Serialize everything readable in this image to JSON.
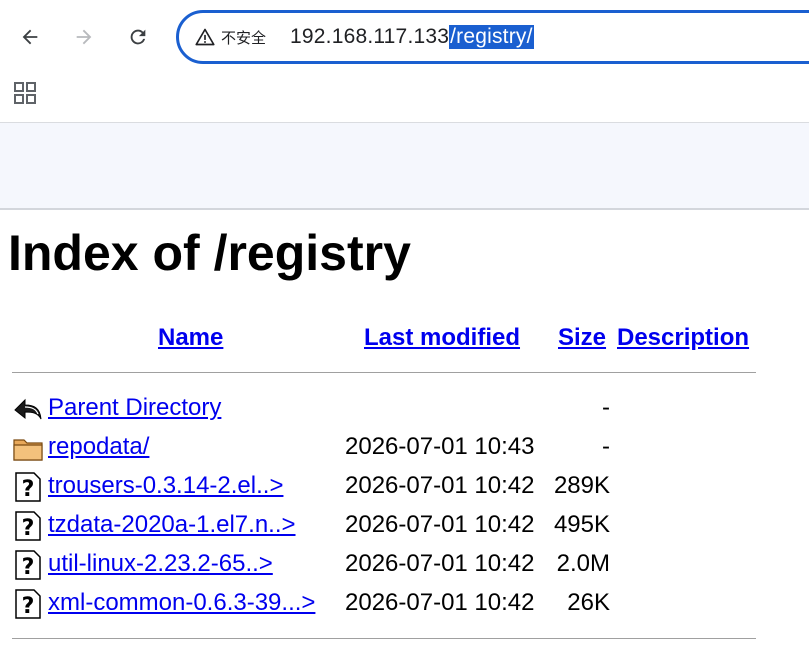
{
  "browser": {
    "insecure_label": "不安全",
    "url_host": "192.168.117.133",
    "url_path": "/registry/"
  },
  "page": {
    "title": "Index of /registry"
  },
  "columns": {
    "name": "Name",
    "last_modified": "Last modified",
    "size": "Size",
    "description": "Description"
  },
  "rows": [
    {
      "name": "Parent Directory",
      "date": "",
      "size": "-",
      "icon": "back-arrow-icon"
    },
    {
      "name": "repodata/",
      "date": "2026-07-01 10:43",
      "size": "-",
      "icon": "folder-icon"
    },
    {
      "name": "trousers-0.3.14-2.el..>",
      "date": "2026-07-01 10:42",
      "size": "289K",
      "icon": "unknown-file-icon"
    },
    {
      "name": "tzdata-2020a-1.el7.n..>",
      "date": "2026-07-01 10:42",
      "size": "495K",
      "icon": "unknown-file-icon"
    },
    {
      "name": "util-linux-2.23.2-65..>",
      "date": "2026-07-01 10:42",
      "size": "2.0M",
      "icon": "unknown-file-icon"
    },
    {
      "name": "xml-common-0.6.3-39...>",
      "date": "2026-07-01 10:42",
      "size": "26K",
      "icon": "unknown-file-icon"
    }
  ],
  "colors": {
    "link": "#0000ee",
    "omnibox_border": "#1a5fd0",
    "selection": "#1a5fd0"
  }
}
